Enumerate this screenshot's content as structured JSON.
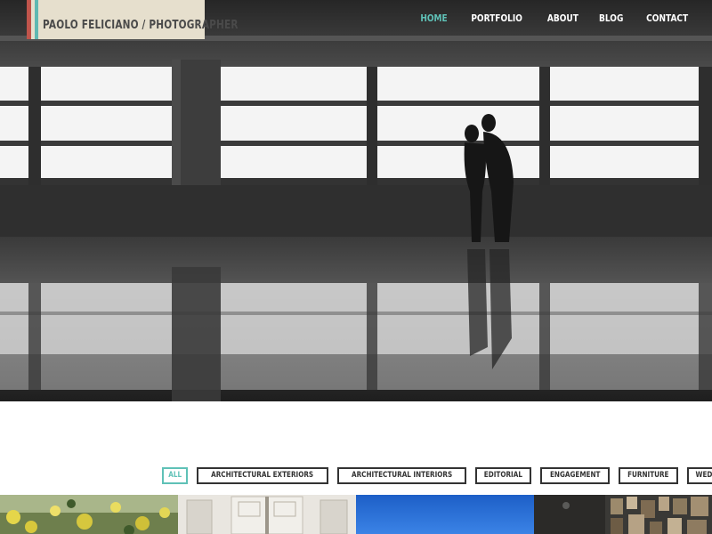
{
  "site": {
    "title": "PAOLO FELICIANO / PHOTOGRAPHER"
  },
  "nav": {
    "items": [
      "HOME",
      "PORTFOLIO",
      "ABOUT",
      "BLOG",
      "CONTACT"
    ],
    "active_index": 0
  },
  "hero": {
    "description": "black and white photo of a couple silhouetted against large windows, reflected on a polished floor"
  },
  "filters": {
    "items": [
      "ALL",
      "ARCHITECTURAL EXTERIORS",
      "ARCHITECTURAL INTERIORS",
      "EDITORIAL",
      "ENGAGEMENT",
      "FURNITURE",
      "WEDDING"
    ],
    "active_index": 0
  },
  "thumbnails": [
    {
      "subject": "yellow flowers and greenery"
    },
    {
      "subject": "white ornate interior doors"
    },
    {
      "subject": "blue sky"
    },
    {
      "subject": "dark wall with framed pictures"
    }
  ],
  "colors": {
    "accent": "#5fc1b7",
    "logo_bg": "#e6dfcd",
    "logo_stripe_red": "#c0544b",
    "logo_stripe_teal": "#5fb8b2",
    "filter_border": "#333333"
  }
}
